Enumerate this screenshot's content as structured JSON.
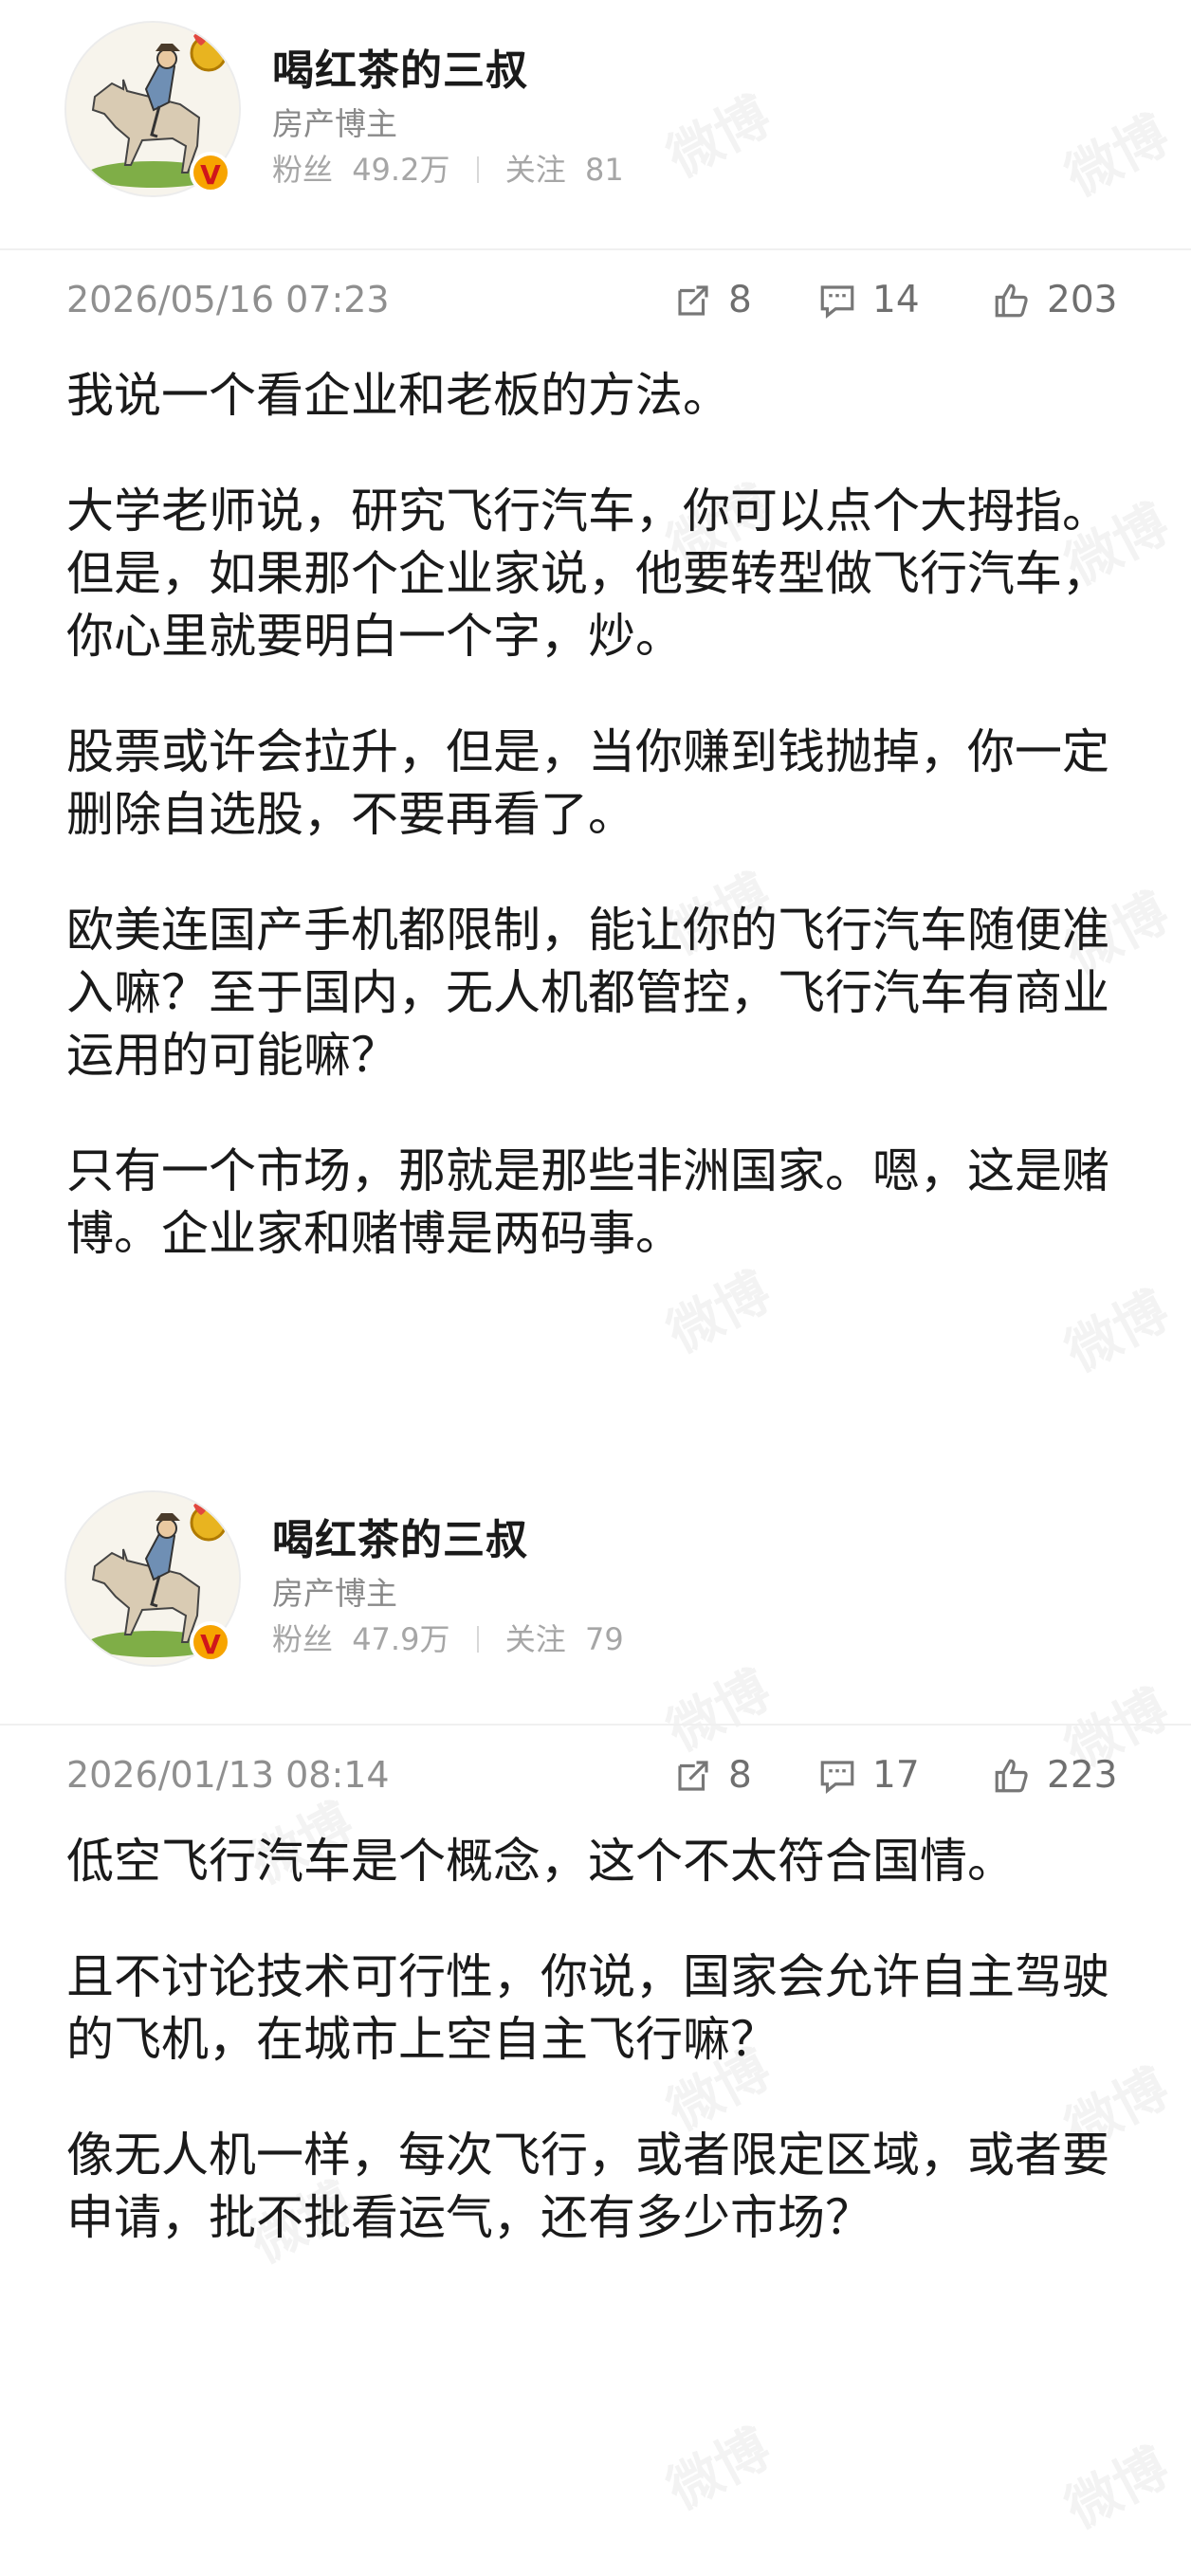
{
  "post1": {
    "author": {
      "name": "喝红茶的三叔",
      "role": "房产博主",
      "fans_label": "粉丝",
      "fans": "49.2万",
      "follow_label": "关注",
      "follow": "81"
    },
    "date": "2026/05/16 07:23",
    "actions": {
      "repost": "8",
      "comment": "14",
      "like": "203"
    },
    "paragraphs": [
      "我说一个看企业和老板的方法。",
      "大学老师说，研究飞行汽车，你可以点个大拇指。但是，如果那个企业家说，他要转型做飞行汽车，你心里就要明白一个字，炒。",
      "股票或许会拉升，但是，当你赚到钱抛掉，你一定删除自选股，不要再看了。",
      "欧美连国产手机都限制，能让你的飞行汽车随便准入嘛？至于国内，无人机都管控，飞行汽车有商业运用的可能嘛？",
      "只有一个市场，那就是那些非洲国家。嗯，这是赌博。企业家和赌博是两码事。"
    ]
  },
  "post2": {
    "author": {
      "name": "喝红茶的三叔",
      "role": "房产博主",
      "fans_label": "粉丝",
      "fans": "47.9万",
      "follow_label": "关注",
      "follow": "79"
    },
    "date": "2026/01/13 08:14",
    "actions": {
      "repost": "8",
      "comment": "17",
      "like": "223"
    },
    "paragraphs": [
      "低空飞行汽车是个概念，这个不太符合国情。",
      "且不讨论技术可行性，你说，国家会允许自主驾驶的飞机，在城市上空自主飞行嘛？",
      "像无人机一样，每次飞行，或者限定区域，或者要申请，批不批看运气，还有多少市场？"
    ]
  },
  "watermark_text": "微博",
  "colors": {
    "verified_badge": "#f7a400",
    "verified_v": "#d0161b"
  },
  "icons": [
    "repost-icon",
    "comment-icon",
    "like-icon"
  ]
}
